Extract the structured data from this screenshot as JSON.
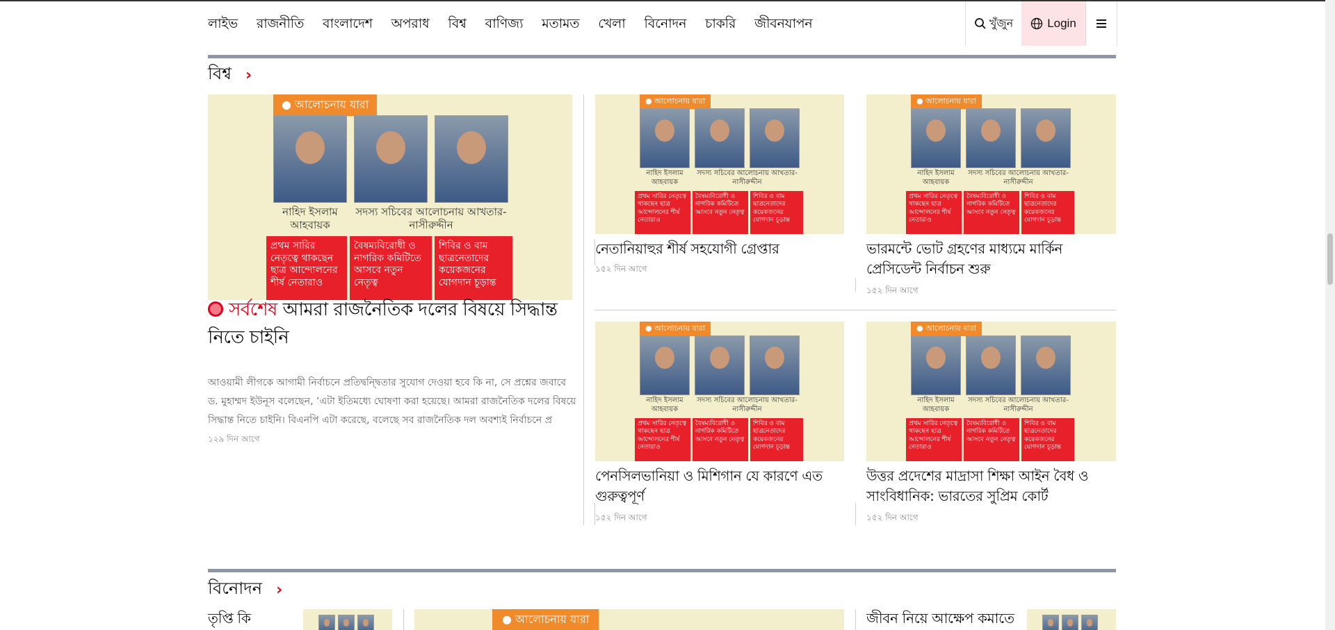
{
  "nav": {
    "items": [
      "লাইভ",
      "রাজনীতি",
      "বাংলাদেশ",
      "অপরাধ",
      "বিশ্ব",
      "বাণিজ্য",
      "মতামত",
      "খেলা",
      "বিনোদন",
      "চাকরি",
      "জীবনযাপন"
    ],
    "search_label": "খুঁজুন",
    "login_label": "Login"
  },
  "image_text": {
    "tag": "● আলোচনায় যারা",
    "cap1": "নাহিদ ইসলাম আহবায়ক",
    "cap2": "সদস্য সচিবের আলোচনায় আখতার-নাসীরুদ্দীন",
    "red1": "প্রথম সারির নেতৃত্বে থাকছেন ছাত্র আন্দোলনের শীর্ষ নেতারাও",
    "red2": "বৈষম্যবিরোধী ও নাগরিক কমিটিতে আসবে নতুন নেতৃত্ব",
    "red3": "শিবির ও বাম ছাত্রনেতাদের কয়েকজনের যোগদান চূড়ান্ত"
  },
  "world": {
    "title": "বিশ্ব",
    "lead": {
      "latest": "সর্বশেষ",
      "headline": "আমরা রাজনৈতিক দলের বিষয়ে সিদ্ধান্ত নিতে চাইনি",
      "summary": "আওয়ামী লীগকে আগামী নির্বাচনে প্রতিদ্বন্দ্বিতার সুযোগ দেওয়া হবে কি না, সে প্রশ্নের জবাবে ড. মুহাম্মদ ইউনূস বলেছেন, ‘এটা ইতিমধ্যে ঘোষণা করা হয়েছে। আমরা রাজনৈতিক দলের বিষয়ে সিদ্ধান্ত নিতে চাইনি। বিএনপি এটা করেছে, বলেছে সব রাজনৈতিক দল অবশ্যই নির্বাচনে প্র",
      "time": "১২৯ দিন আগে"
    },
    "cards": [
      {
        "headline": "নেতানিয়াহুর শীর্ষ সহযোগী গ্রেপ্তার",
        "time": "১৫২ দিন আগে"
      },
      {
        "headline": "ভারমন্টে ভোট গ্রহণের মাধ্যমে মার্কিন প্রেসিডেন্ট নির্বাচন শুরু",
        "time": "১৫২ দিন আগে"
      },
      {
        "headline": "পেনসিলভানিয়া ও মিশিগান যে কারণে এত গুরুত্বপূর্ণ",
        "time": "১৫২ দিন আগে"
      },
      {
        "headline": "উত্তর প্রদেশের মাদ্রাসা শিক্ষা আইন বৈধ ও সাংবিধানিক: ভারতের সুপ্রিম কোর্ট",
        "time": "১৫২ দিন আগে"
      }
    ]
  },
  "entertainment": {
    "title": "বিনোদন",
    "left_headline": "তৃপ্তি কি লড়াইয়ে",
    "right_headline": "জীবন নিয়ে আক্ষেপ কমাতে"
  },
  "icons": {
    "search": "search-icon",
    "globe": "globe-icon",
    "menu": "hamburger-menu-icon",
    "chevron": "chevron-right-icon",
    "live_dot": "live-dot-icon"
  },
  "colors": {
    "accent": "#e0001b",
    "section_bar": "#8c96a8",
    "login_bg": "#fde3e6",
    "image_bg": "#f3efcc"
  }
}
